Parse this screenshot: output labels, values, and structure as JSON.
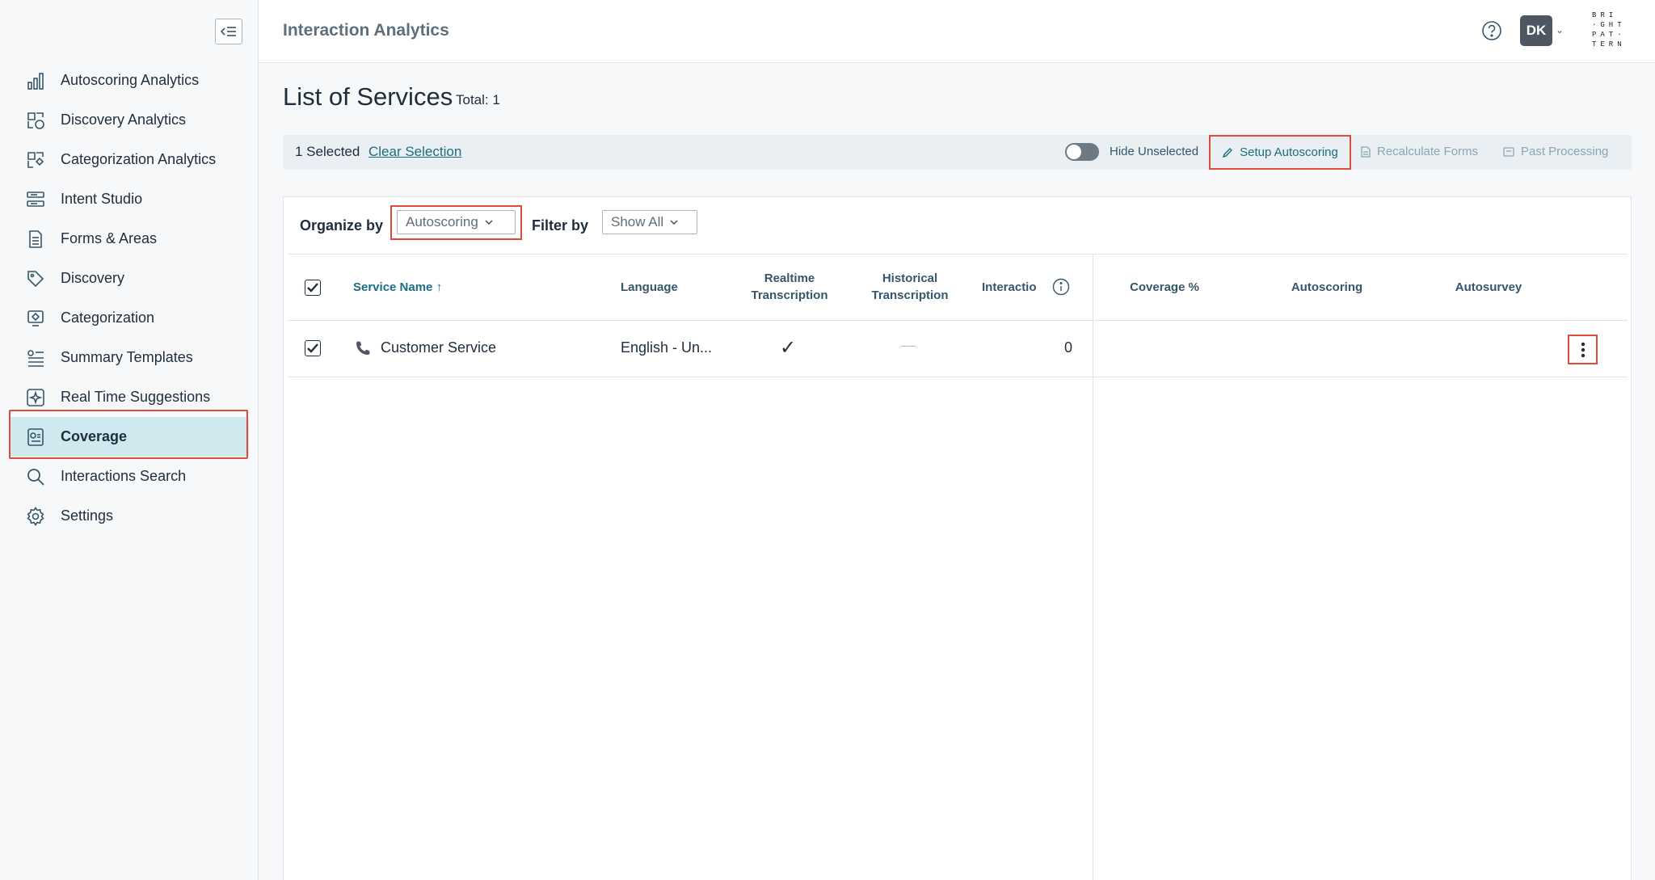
{
  "header": {
    "app_title": "Interaction Analytics",
    "avatar_initials": "DK",
    "logo_lines": [
      "BRI",
      "·GHT",
      "PAT·",
      "TERN"
    ]
  },
  "sidebar": {
    "items": [
      {
        "label": "Autoscoring Analytics",
        "icon": "bar-chart-icon"
      },
      {
        "label": "Discovery Analytics",
        "icon": "discovery-analytics-icon"
      },
      {
        "label": "Categorization Analytics",
        "icon": "categorization-analytics-icon"
      },
      {
        "label": "Intent Studio",
        "icon": "intent-studio-icon"
      },
      {
        "label": "Forms & Areas",
        "icon": "forms-icon"
      },
      {
        "label": "Discovery",
        "icon": "tag-icon"
      },
      {
        "label": "Categorization",
        "icon": "categorization-icon"
      },
      {
        "label": "Summary Templates",
        "icon": "summary-templates-icon"
      },
      {
        "label": "Real Time Suggestions",
        "icon": "suggestions-icon"
      },
      {
        "label": "Coverage",
        "icon": "coverage-icon",
        "active": true
      },
      {
        "label": "Interactions Search",
        "icon": "search-icon"
      },
      {
        "label": "Settings",
        "icon": "gear-icon"
      }
    ]
  },
  "page": {
    "title": "List of Services",
    "total": "Total: 1"
  },
  "selection_bar": {
    "count": "1 Selected",
    "clear": "Clear Selection",
    "hide_unselected": "Hide Unselected",
    "setup_autoscoring": "Setup Autoscoring",
    "recalculate_forms": "Recalculate Forms",
    "past_processing": "Past Processing"
  },
  "toolbar": {
    "organize_label": "Organize by",
    "organize_value": "Autoscoring",
    "filter_label": "Filter by",
    "filter_value": "Show All"
  },
  "table": {
    "columns": {
      "service_name": "Service Name",
      "language": "Language",
      "realtime_1": "Realtime",
      "realtime_2": "Transcription",
      "historical_1": "Historical",
      "historical_2": "Transcription",
      "interactions": "Interactio",
      "coverage": "Coverage %",
      "autoscoring": "Autoscoring",
      "autosurvey": "Autosurvey"
    },
    "rows": [
      {
        "service_name": "Customer Service",
        "language": "English - Un...",
        "realtime": "✓",
        "historical": "—",
        "interactions": "0",
        "coverage": "",
        "autoscoring": "",
        "autosurvey": ""
      }
    ]
  },
  "colors": {
    "accent": "#1d6d80",
    "highlight": "#e04a3a",
    "active_nav": "#cfe9ee"
  }
}
